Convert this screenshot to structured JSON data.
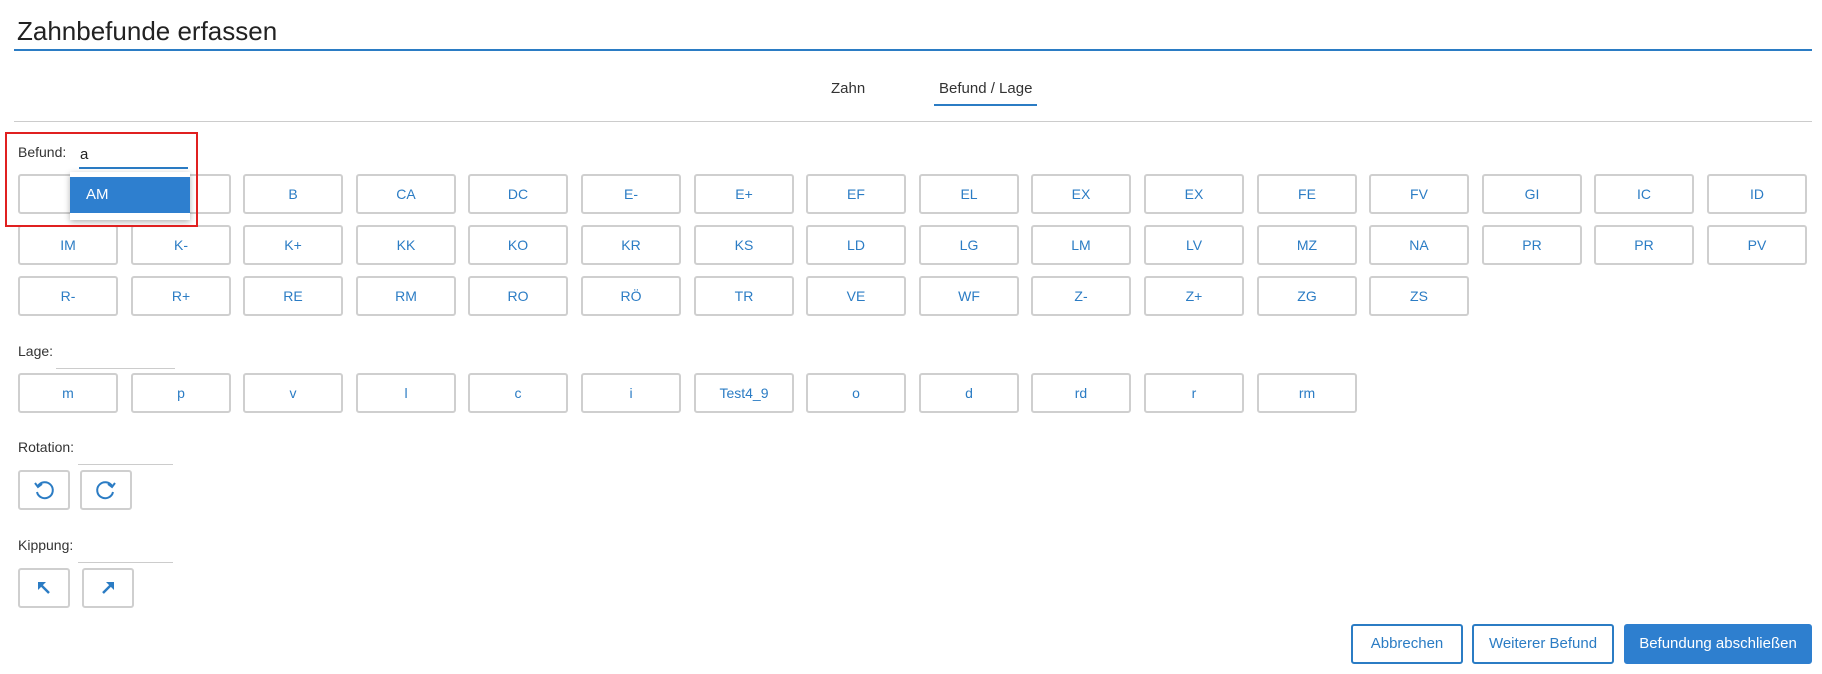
{
  "page": {
    "title": "Zahnbefunde erfassen"
  },
  "tabs": [
    {
      "label": "Zahn",
      "active": false
    },
    {
      "label": "Befund / Lage",
      "active": true
    }
  ],
  "befund": {
    "label": "Befund:",
    "value": "a",
    "dropdown_options": [
      "AM"
    ],
    "buttons": [
      "",
      "",
      "B",
      "CA",
      "DC",
      "E-",
      "E+",
      "EF",
      "EL",
      "EX",
      "EX",
      "FE",
      "FV",
      "GI",
      "IC",
      "ID",
      "IM",
      "K-",
      "K+",
      "KK",
      "KO",
      "KR",
      "KS",
      "LD",
      "LG",
      "LM",
      "LV",
      "MZ",
      "NA",
      "PR",
      "PR",
      "PV",
      "R-",
      "R+",
      "RE",
      "RM",
      "RO",
      "RÖ",
      "TR",
      "VE",
      "WF",
      "Z-",
      "Z+",
      "ZG",
      "ZS"
    ]
  },
  "lage": {
    "label": "Lage:",
    "buttons": [
      "m",
      "p",
      "v",
      "l",
      "c",
      "i",
      "Test4_9",
      "o",
      "d",
      "rd",
      "r",
      "rm"
    ]
  },
  "rotation": {
    "label": "Rotation:",
    "buttons": [
      {
        "icon": "rotate-counterclockwise-icon"
      },
      {
        "icon": "rotate-clockwise-icon"
      }
    ]
  },
  "kippung": {
    "label": "Kippung:",
    "buttons": [
      {
        "icon": "arrow-up-left-icon"
      },
      {
        "icon": "arrow-up-right-icon"
      }
    ]
  },
  "footer": {
    "cancel": "Abbrechen",
    "next": "Weiterer Befund",
    "finish": "Befundung abschließen"
  },
  "colors": {
    "accent": "#2b7cc4",
    "primary": "#2e7fcf",
    "highlight": "#e02020"
  }
}
